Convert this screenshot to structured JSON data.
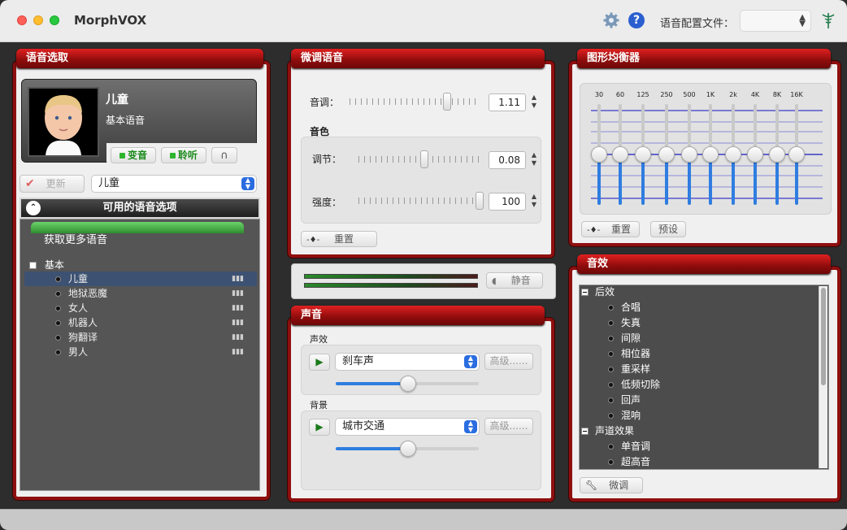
{
  "app": {
    "title": "MorphVOX"
  },
  "toolbar": {
    "profile_label": "语音配置文件：",
    "profile_value": ""
  },
  "voice_select": {
    "header": "语音选取",
    "voice_name": "儿童",
    "voice_type": "基本语音",
    "morph_label": "变音",
    "listen_label": "聆听",
    "update_label": "更新",
    "current_voice": "儿童",
    "available_header": "可用的语音选项",
    "get_more": "获取更多语音",
    "group": "基本",
    "voices": [
      "儿童",
      "地狱恶魔",
      "女人",
      "机器人",
      "狗翻译",
      "男人"
    ]
  },
  "tweak": {
    "header": "微调语音",
    "pitch_label": "音调：",
    "pitch_value": "1.11",
    "timbre_label": "音色",
    "adjust_label": "调节：",
    "adjust_value": "0.08",
    "strength_label": "强度：",
    "strength_value": "100",
    "reset_label": "重置"
  },
  "level": {
    "mute_label": "静音"
  },
  "sound": {
    "header": "声音",
    "effects_label": "声效",
    "effect_value": "刹车声",
    "advanced1": "高级......",
    "background_label": "背景",
    "background_value": "城市交通",
    "advanced2": "高级......"
  },
  "eq": {
    "header": "图形均衡器",
    "bands": [
      "30",
      "60",
      "125",
      "250",
      "500",
      "1K",
      "2k",
      "4K",
      "8K",
      "16K"
    ],
    "reset_label": "重置",
    "preset_label": "预设"
  },
  "effects": {
    "header": "音效",
    "group1": "后效",
    "group1_items": [
      "合唱",
      "失真",
      "间隙",
      "相位器",
      "重采样",
      "低频切除",
      "回声",
      "混响"
    ],
    "group2": "声道效果",
    "group2_items": [
      "单音调",
      "超高音"
    ],
    "tweak_label": "微调"
  }
}
